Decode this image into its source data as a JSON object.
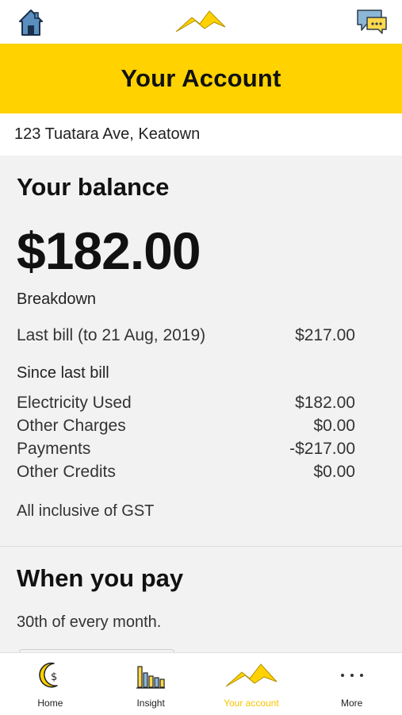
{
  "top_bar": {
    "home_icon": "home-icon",
    "logo_icon": "mountain-logo-icon",
    "chat_icon": "chat-icon"
  },
  "banner": {
    "title": "Your Account"
  },
  "address": "123 Tuatara Ave, Keatown",
  "balance": {
    "heading": "Your balance",
    "amount": "$182.00",
    "breakdown_label": "Breakdown",
    "last_bill": {
      "label": "Last bill (to 21 Aug, 2019)",
      "value": "$217.00"
    },
    "since_label": "Since last bill",
    "items": [
      {
        "label": "Electricity Used",
        "value": "$182.00"
      },
      {
        "label": "Other Charges",
        "value": "$0.00"
      },
      {
        "label": "Payments",
        "value": "-$217.00"
      },
      {
        "label": "Other Credits",
        "value": "$0.00"
      }
    ],
    "gst_note": "All inclusive of GST"
  },
  "when_you_pay": {
    "heading": "When you pay",
    "day": "30th of every month."
  },
  "tabs": [
    {
      "label": "Home",
      "icon": "moon-dollar-icon",
      "active": false
    },
    {
      "label": "Insight",
      "icon": "bar-chart-icon",
      "active": false
    },
    {
      "label": "Your account",
      "icon": "mountain-logo-icon",
      "active": true
    },
    {
      "label": "More",
      "icon": "more-dots-icon",
      "active": false
    }
  ],
  "colors": {
    "accent": "#ffd200",
    "active_tab_text": "#f5c400",
    "panel_bg": "#f2f2f2"
  }
}
